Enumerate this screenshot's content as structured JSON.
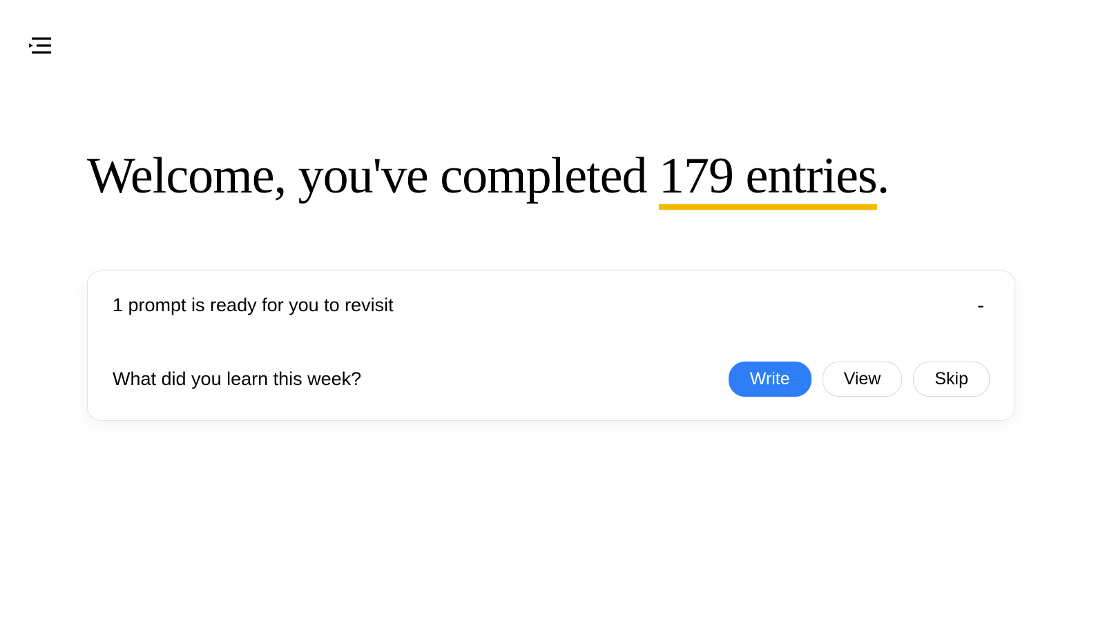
{
  "heading": {
    "prefix": "Welcome, you've completed ",
    "highlight": "179 entries",
    "suffix": "."
  },
  "prompt_card": {
    "title": "1 prompt is ready for you to revisit",
    "collapse_symbol": "-",
    "prompt_question": "What did you learn this week?",
    "buttons": {
      "write": "Write",
      "view": "View",
      "skip": "Skip"
    }
  }
}
